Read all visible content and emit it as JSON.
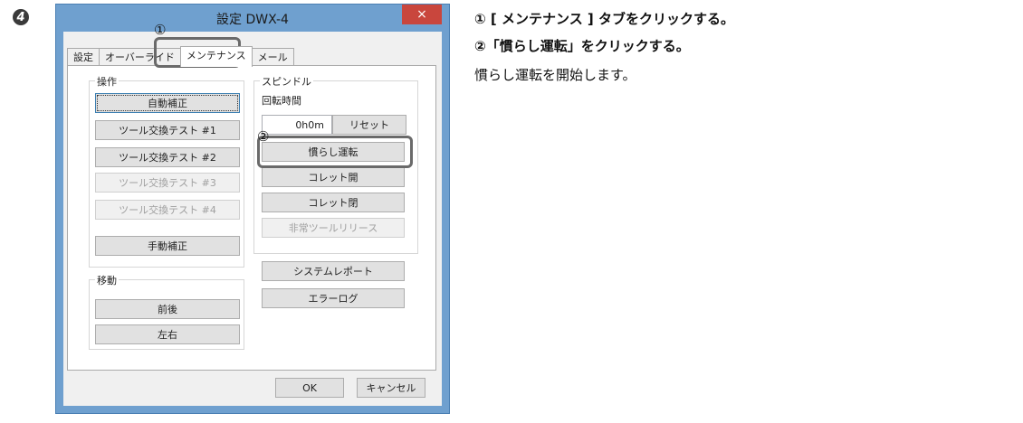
{
  "step_number": "4",
  "window": {
    "title": "設定 DWX-4",
    "close_glyph": "×",
    "tabs": [
      "設定",
      "オーバーライド",
      "メンテナンス",
      "メール"
    ],
    "operation_group": {
      "label": "操作",
      "buttons": [
        {
          "label": "自動補正",
          "enabled": true
        },
        {
          "label": "ツール交換テスト #1",
          "enabled": true
        },
        {
          "label": "ツール交換テスト #2",
          "enabled": true
        },
        {
          "label": "ツール交換テスト #3",
          "enabled": false
        },
        {
          "label": "ツール交換テスト #4",
          "enabled": false
        },
        {
          "label": "手動補正",
          "enabled": true
        }
      ]
    },
    "move_group": {
      "label": "移動",
      "buttons": [
        "前後",
        "左右"
      ]
    },
    "spindle_group": {
      "label": "スピンドル",
      "rotation_time_label": "回転時間",
      "rotation_time_value": "0h0m",
      "reset_label": "リセット",
      "buttons": [
        {
          "label": "慣らし運転",
          "enabled": true
        },
        {
          "label": "コレット開",
          "enabled": true
        },
        {
          "label": "コレット閉",
          "enabled": true
        },
        {
          "label": "非常ツールリリース",
          "enabled": false
        }
      ]
    },
    "system_report_label": "システムレポート",
    "error_log_label": "エラーログ",
    "ok_label": "OK",
    "cancel_label": "キャンセル"
  },
  "markers": [
    "①",
    "②"
  ],
  "instructions": [
    "① [ メンテナンス ] タブをクリックする。",
    "②「慣らし運転」をクリックする。",
    "慣らし運転を開始します。"
  ]
}
